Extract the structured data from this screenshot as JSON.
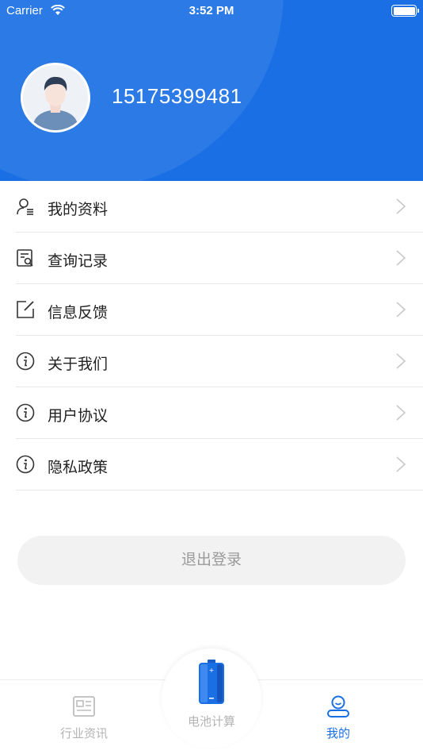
{
  "status_bar": {
    "carrier": "Carrier",
    "time": "3:52 PM"
  },
  "profile": {
    "phone": "15175399481"
  },
  "menu": [
    {
      "label": "我的资料",
      "icon": "user-profile-icon"
    },
    {
      "label": "查询记录",
      "icon": "search-record-icon"
    },
    {
      "label": "信息反馈",
      "icon": "edit-feedback-icon"
    },
    {
      "label": "关于我们",
      "icon": "info-icon"
    },
    {
      "label": "用户协议",
      "icon": "info-icon"
    },
    {
      "label": "隐私政策",
      "icon": "info-icon"
    }
  ],
  "logout_label": "退出登录",
  "tabs": [
    {
      "label": "行业资讯",
      "icon": "news-icon",
      "active": false
    },
    {
      "label": "电池计算",
      "icon": "battery-icon",
      "active": false
    },
    {
      "label": "我的",
      "icon": "profile-tab-icon",
      "active": true
    }
  ],
  "colors": {
    "primary": "#1a6fe4",
    "inactive": "#b3b3b3",
    "separator": "#e8e8e8"
  }
}
